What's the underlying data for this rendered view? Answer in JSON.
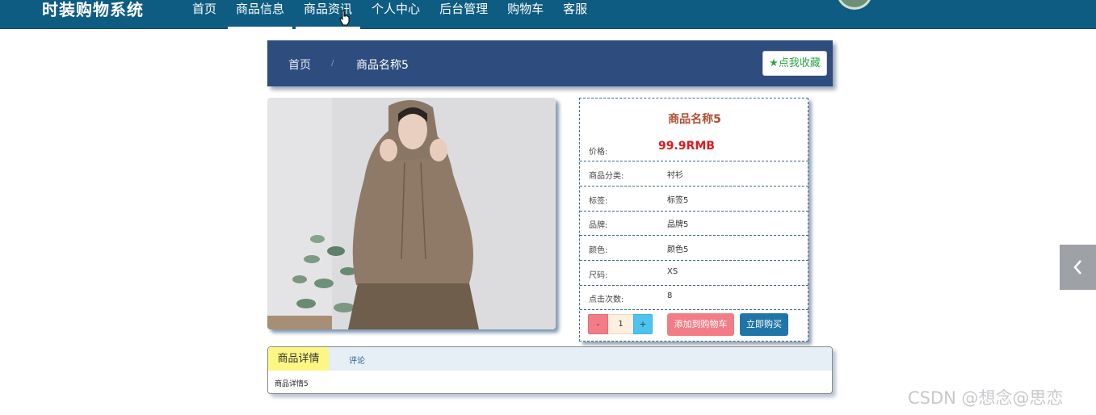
{
  "brand": "时装购物系统",
  "nav": [
    {
      "label": "首页"
    },
    {
      "label": "商品信息"
    },
    {
      "label": "商品资讯"
    },
    {
      "label": "个人中心"
    },
    {
      "label": "后台管理"
    },
    {
      "label": "购物车"
    },
    {
      "label": "客服"
    }
  ],
  "breadcrumb": {
    "home": "首页",
    "separator": "/",
    "current": "商品名称5"
  },
  "favorite_button": "★点我收藏",
  "product": {
    "title": "商品名称5",
    "price_label": "价格:",
    "price": "99.9RMB",
    "fields": [
      {
        "label": "商品分类:",
        "value": "衬衫"
      },
      {
        "label": "标签:",
        "value": "标签5"
      },
      {
        "label": "品牌:",
        "value": "品牌5"
      },
      {
        "label": "颜色:",
        "value": "颜色5"
      },
      {
        "label": "尺码:",
        "value": "XS"
      },
      {
        "label": "点击次数:",
        "value": "8"
      }
    ]
  },
  "quantity": {
    "minus": "-",
    "value": "1",
    "plus": "+"
  },
  "actions": {
    "add_to_cart": "添加到购物车",
    "buy_now": "立即购买"
  },
  "tabs": {
    "active": "商品详情",
    "second": "评论",
    "content": "商品详情5"
  },
  "watermark": "CSDN @想念@思恋",
  "colors": {
    "topbar": "#0e5c82",
    "breadcrumb_bar": "#2e4d7e",
    "price": "#e4161d",
    "cart_button": "#f27d86",
    "buy_button": "#1f75a8",
    "active_tab": "#fcf782"
  },
  "icons": {
    "favorite": "star-icon",
    "side_toggle": "chevron-left-icon",
    "cursor": "hand-pointer-icon"
  }
}
